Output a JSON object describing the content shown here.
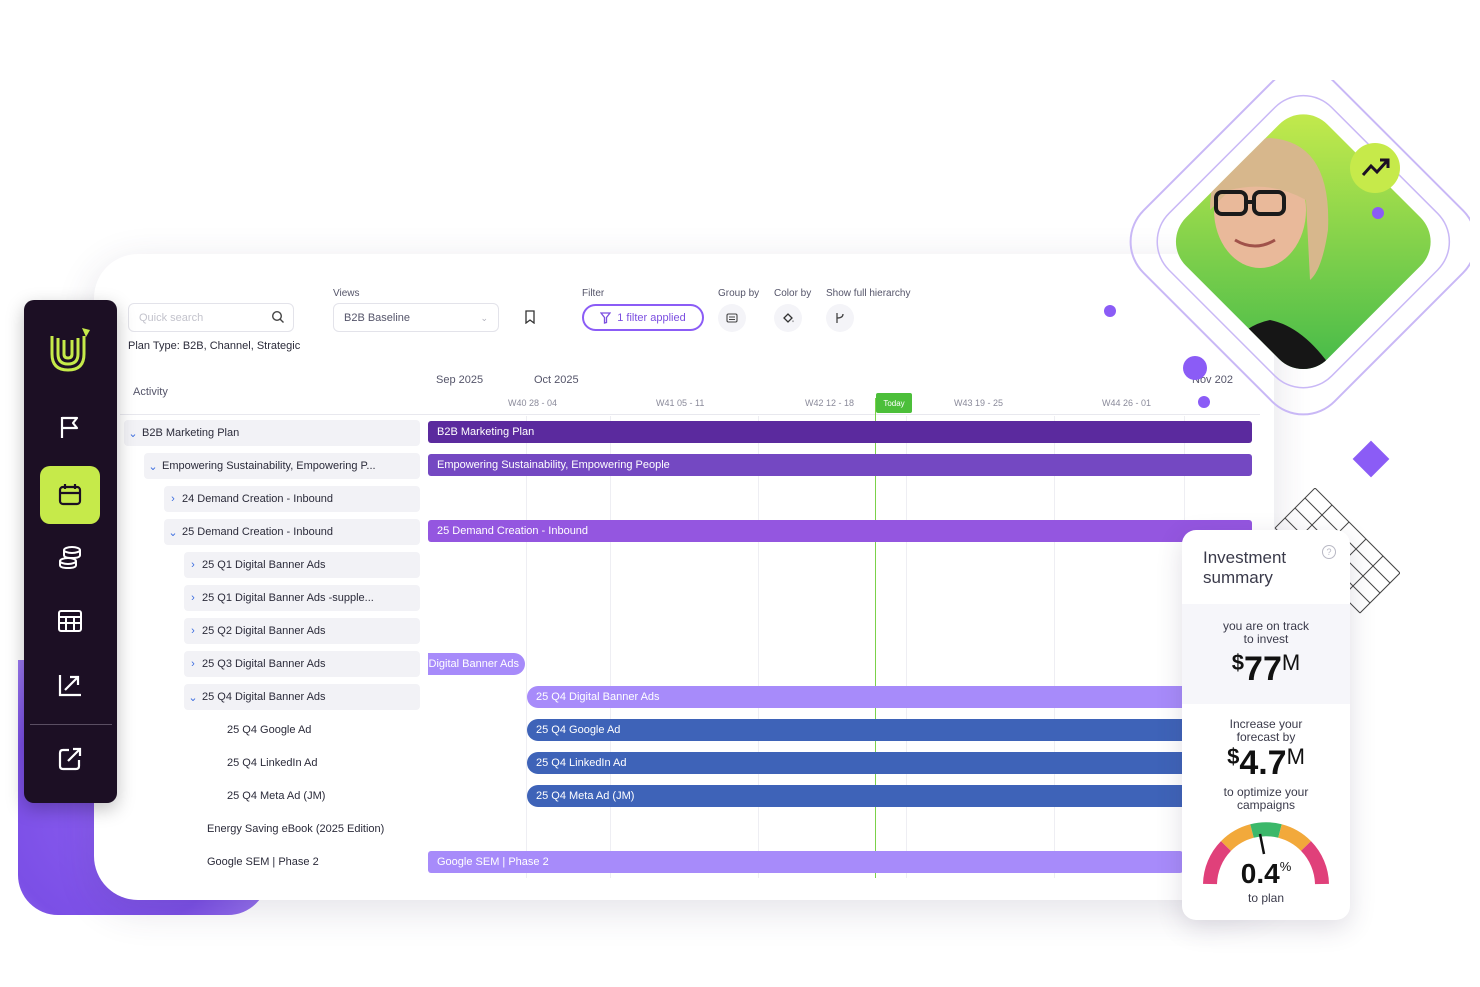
{
  "toolbar": {
    "search_placeholder": "Quick search",
    "views_label": "Views",
    "views_value": "B2B Baseline",
    "filter_label": "Filter",
    "filter_button": "1 filter applied",
    "group_by_label": "Group by",
    "color_by_label": "Color by",
    "hierarchy_label": "Show full hierarchy",
    "plan_type": "Plan Type: B2B, Channel, Strategic"
  },
  "sidebar": {
    "items": [
      {
        "icon": "flag-icon"
      },
      {
        "icon": "calendar-icon",
        "active": true
      },
      {
        "icon": "coins-icon"
      },
      {
        "icon": "table-icon"
      },
      {
        "icon": "chart-up-icon"
      },
      {
        "icon": "export-icon"
      }
    ]
  },
  "gantt": {
    "activity_header": "Activity",
    "months": [
      "Sep 2025",
      "Oct 2025",
      "Nov 202"
    ],
    "weeks": [
      "W40 28 - 04",
      "W41 05 - 11",
      "W42 12 - 18",
      "W43 19 - 25",
      "W44 26 - 01"
    ],
    "today_label": "Today",
    "rows": [
      {
        "label": "B2B Marketing Plan",
        "caret": "v"
      },
      {
        "label": "Empowering Sustainability, Empowering P...",
        "caret": "v"
      },
      {
        "label": "24 Demand Creation - Inbound",
        "caret": ">"
      },
      {
        "label": "25 Demand Creation - Inbound",
        "caret": "v"
      },
      {
        "label": "25 Q1 Digital Banner Ads",
        "caret": ">"
      },
      {
        "label": "25 Q1 Digital Banner Ads -supple...",
        "caret": ">"
      },
      {
        "label": "25 Q2 Digital Banner Ads",
        "caret": ">"
      },
      {
        "label": "25 Q3 Digital Banner Ads",
        "caret": ">"
      },
      {
        "label": "25 Q4 Digital Banner Ads",
        "caret": "v"
      },
      {
        "label": "25 Q4 Google Ad",
        "caret": ""
      },
      {
        "label": "25 Q4 LinkedIn Ad",
        "caret": ""
      },
      {
        "label": "25 Q4 Meta Ad (JM)",
        "caret": ""
      },
      {
        "label": "Energy Saving eBook (2025 Edition)",
        "caret": ""
      },
      {
        "label": "Google SEM | Phase 2",
        "caret": ""
      }
    ],
    "bars": [
      {
        "label": "B2B Marketing Plan",
        "color": "#5b2a9e"
      },
      {
        "label": "Empowering Sustainability, Empowering People",
        "color": "#7448c2"
      },
      {
        "label": "25 Demand Creation - Inbound",
        "color": "#9456e0"
      },
      {
        "label": "Digital Banner Ads",
        "color": "#a78bfa"
      },
      {
        "label": "25 Q4 Digital Banner Ads",
        "color": "#a78bfa"
      },
      {
        "label": "25 Q4 Google Ad",
        "color": "#3e63b8"
      },
      {
        "label": "25 Q4 LinkedIn Ad",
        "color": "#3e63b8"
      },
      {
        "label": "25 Q4 Meta Ad (JM)",
        "color": "#3e63b8"
      },
      {
        "label": "Google SEM | Phase 2",
        "color": "#a78bfa"
      }
    ]
  },
  "investment": {
    "title": "Investment summary",
    "help": "?",
    "on_track": "you are on track to invest",
    "invest_currency": "$",
    "invest_value": "77",
    "invest_unit": "M",
    "increase_text": "Increase your forecast by",
    "increase_currency": "$",
    "increase_value": "4.7",
    "increase_unit": "M",
    "optimize_text": "to optimize your campaigns",
    "gauge_value": "0.4",
    "gauge_unit": "%",
    "gauge_caption": "to plan"
  },
  "colors": {
    "accent_lime": "#c6ea4a",
    "sidebar_bg": "#1c0f24",
    "filter_purple": "#8b5cf6",
    "today_green": "#4cbf3a"
  }
}
